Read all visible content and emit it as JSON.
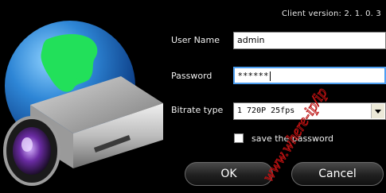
{
  "app": {
    "client_version": "Client version: 2. 1. 0. 3"
  },
  "form": {
    "user_label": "User Name",
    "user_value": "admin",
    "password_label": "Password",
    "password_value": "******",
    "bitrate_label": "Bitrate type",
    "bitrate_value": "1 720P 25fps",
    "save_password_label": "save the password",
    "save_password_checked": false
  },
  "buttons": {
    "ok": "OK",
    "cancel": "Cancel"
  },
  "icons": [
    "globe-icon",
    "security-camera-icon",
    "dropdown-arrow-icon",
    "watermark"
  ],
  "watermark_text": "www.where-ip/ip"
}
